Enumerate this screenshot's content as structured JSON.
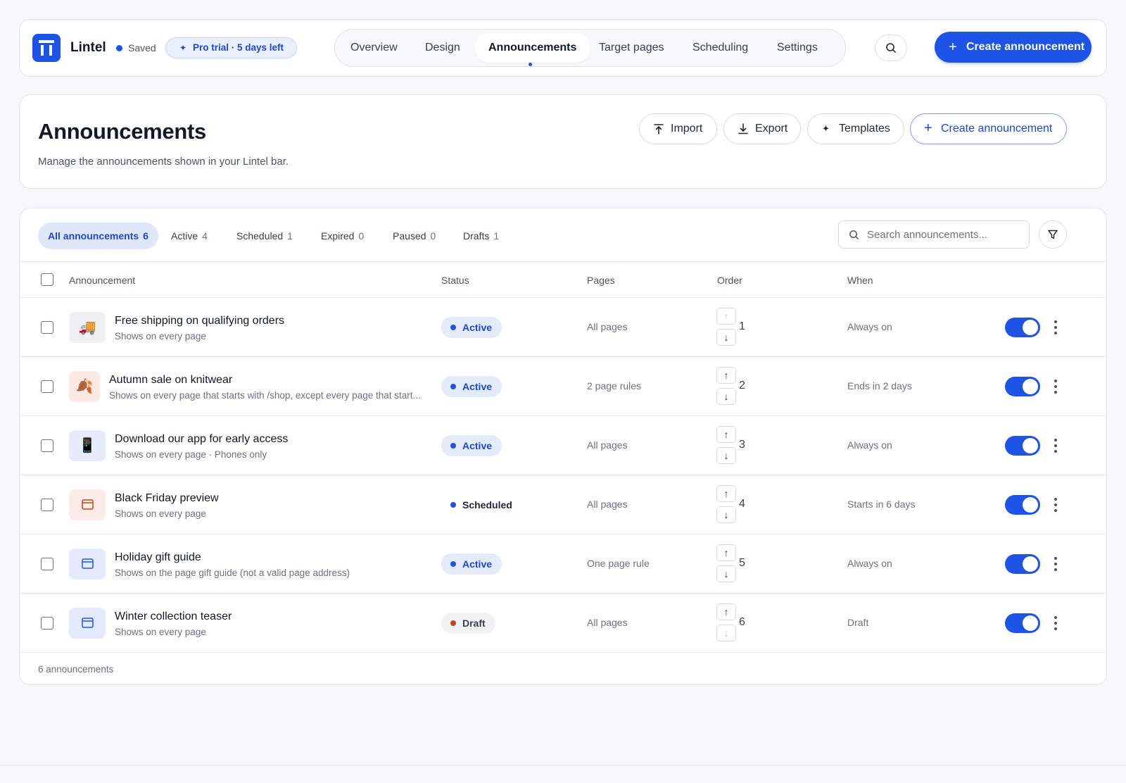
{
  "topbar": {
    "brand": "Lintel",
    "saved": "Saved",
    "trial": "Pro trial · 5 days left",
    "nav": [
      "Overview",
      "Design",
      "Announcements",
      "Target pages",
      "Scheduling",
      "Settings"
    ],
    "active_nav": "Announcements",
    "create_label": "Create announcement"
  },
  "header": {
    "title": "Announcements",
    "subtitle": "Manage the announcements shown in your Lintel bar.",
    "import_label": "Import",
    "export_label": "Export",
    "templates_label": "Templates",
    "create_label": "Create announcement"
  },
  "filters": [
    {
      "label": "All announcements",
      "count": "6"
    },
    {
      "label": "Active",
      "count": "4"
    },
    {
      "label": "Scheduled",
      "count": "1"
    },
    {
      "label": "Expired",
      "count": "0"
    },
    {
      "label": "Paused",
      "count": "0"
    },
    {
      "label": "Drafts",
      "count": "1"
    }
  ],
  "search": {
    "placeholder": "Search announcements..."
  },
  "columns": {
    "announcement": "Announcement",
    "status": "Status",
    "pages": "Pages",
    "order": "Order",
    "when": "When"
  },
  "rows": [
    {
      "title": "Free shipping on qualifying orders",
      "subtitle": "Shows on every page",
      "icon": "truck-emoji",
      "glyph": "🚚",
      "status": "Active",
      "pages": "All pages",
      "order": "1",
      "when": "Always on"
    },
    {
      "title": "Autumn sale on knitwear",
      "subtitle": "Shows on every page that starts with /shop, except every page that start...",
      "icon": "leaf-emoji",
      "glyph": "🍂",
      "status": "Active",
      "pages": "2 page rules",
      "order": "2",
      "when": "Ends in 2 days"
    },
    {
      "title": "Download our app for early access",
      "subtitle": "Shows on every page · Phones only",
      "icon": "phone-emoji",
      "glyph": "📱",
      "status": "Active",
      "pages": "All pages",
      "order": "3",
      "when": "Always on"
    },
    {
      "title": "Black Friday preview",
      "subtitle": "Shows on every page",
      "icon": "window-icon",
      "glyph": "",
      "status": "Scheduled",
      "pages": "All pages",
      "order": "4",
      "when": "Starts in 6 days"
    },
    {
      "title": "Holiday gift guide",
      "subtitle": "Shows on the page gift guide (not a valid page address)",
      "icon": "window-icon",
      "glyph": "",
      "status": "Active",
      "pages": "One page rule",
      "order": "5",
      "when": "Always on"
    },
    {
      "title": "Winter collection teaser",
      "subtitle": "Shows on every page",
      "icon": "window-icon",
      "glyph": "",
      "status": "Draft",
      "pages": "All pages",
      "order": "6",
      "when": "Draft"
    }
  ],
  "footer": {
    "count": "6 announcements"
  },
  "colors": {
    "accent": "#1e54e6",
    "active_badge_bg": "#e4ebfb",
    "draft_dot": "#c2461c",
    "scheduled_dot": "#1e54e6"
  }
}
